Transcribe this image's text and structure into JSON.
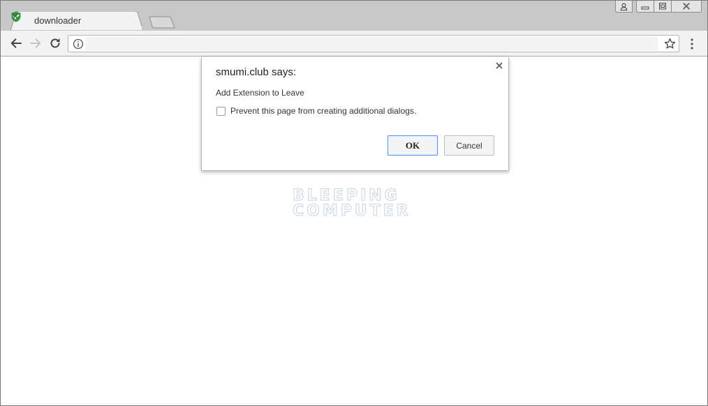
{
  "tab": {
    "title": "downloader",
    "favicon": "green-shield-check-icon"
  },
  "window_controls": [
    "user-icon",
    "minimize-icon",
    "maximize-icon",
    "close-icon"
  ],
  "toolbar": {
    "back": "arrow-left-icon",
    "forward": "arrow-right-icon",
    "reload": "reload-icon",
    "site_info": "info-icon",
    "url": "",
    "bookmark": "star-icon",
    "menu": "kebab-menu-icon"
  },
  "dialog": {
    "title": "smumi.club says:",
    "message": "Add Extension to Leave",
    "checkbox_label": "Prevent this page from creating additional dialogs.",
    "ok_label": "OK",
    "cancel_label": "Cancel"
  },
  "watermark": {
    "line1": "BLEEPING",
    "line2": "COMPUTER"
  },
  "colors": {
    "favicon_green": "#27a243",
    "focus_blue": "#4d90fe",
    "tab_strip": "#c8c8c8",
    "toolbar": "#f2f2f2"
  }
}
